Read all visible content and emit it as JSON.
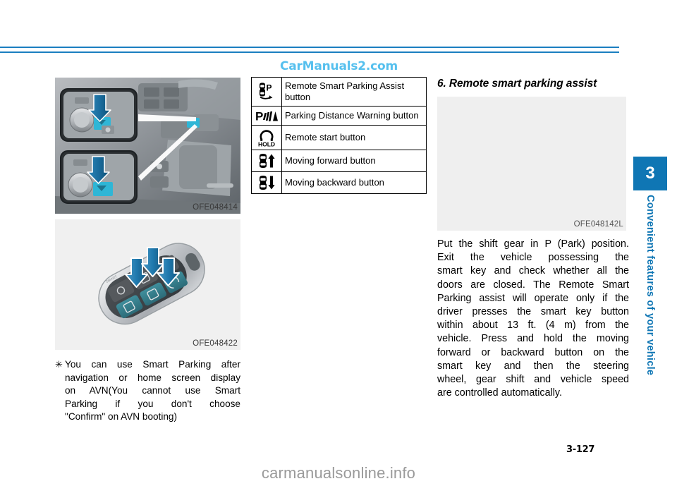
{
  "page": {
    "number": "3-127",
    "chapter_number": "3",
    "chapter_title": "Convenient features of your vehicle",
    "accent_color": "#0F76B4",
    "watermark": "CarManuals2.com",
    "site_footer": "carmanualsonline.info"
  },
  "left_column": {
    "figure_console": {
      "caption": "OFE048414",
      "alt": "Center console with two magnified callouts showing the Smart Parking button highlighted in cyan with blue arrows pointing down"
    },
    "figure_key": {
      "caption": "OFE048422",
      "alt": "Smart key fob with three blue arrows pointing down at the teal remote parking buttons"
    },
    "note": {
      "bullet": "✳",
      "lines": [
        "You can use Smart Parking after",
        "navigation or home screen display",
        "on AVN(You cannot use Smart",
        "Parking if you don't choose",
        "\"Confirm\" on AVN booting)"
      ]
    }
  },
  "middle_column": {
    "table": {
      "rows": [
        {
          "icon": "car-parking-p-icon",
          "label": "Remote Smart Parking Assist button"
        },
        {
          "icon": "parking-distance-warning-icon",
          "label": "Parking Distance Warning button"
        },
        {
          "icon": "remote-start-hold-icon",
          "label": "Remote start button"
        },
        {
          "icon": "car-forward-arrow-icon",
          "label": "Moving forward button"
        },
        {
          "icon": "car-backward-arrow-icon",
          "label": "Moving backward button"
        }
      ]
    }
  },
  "right_column": {
    "heading": "6. Remote smart parking assist",
    "figure": {
      "caption": "OFE048142L",
      "alt": "Blank illustration placeholder"
    },
    "body_lines": [
      "Put the shift gear in P (Park) position.",
      "Exit the vehicle possessing the",
      "smart key and check whether all the",
      "doors are closed. The Remote Smart",
      "Parking assist will operate only if the",
      "driver presses the smart key button",
      "within about 13 ft. (4 m) from the",
      "vehicle. Press and hold the moving",
      "forward or backward button on the",
      "smart key and then the steering",
      "wheel, gear shift and vehicle speed",
      "are controlled automatically."
    ]
  }
}
